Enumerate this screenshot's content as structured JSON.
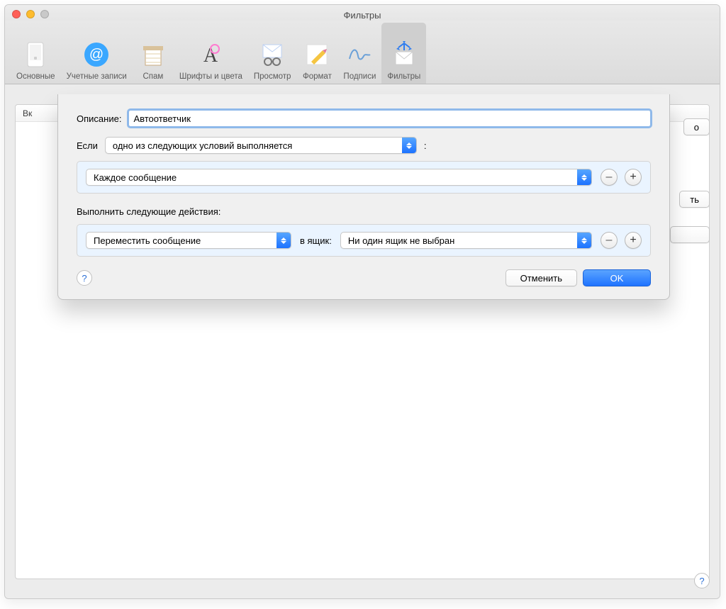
{
  "window": {
    "title": "Фильтры"
  },
  "toolbar": {
    "items": [
      {
        "label": "Основные"
      },
      {
        "label": "Учетные записи"
      },
      {
        "label": "Спам"
      },
      {
        "label": "Шрифты и цвета"
      },
      {
        "label": "Просмотр"
      },
      {
        "label": "Формат"
      },
      {
        "label": "Подписи"
      },
      {
        "label": "Фильтры"
      }
    ],
    "active_index": 7
  },
  "background_list": {
    "header": "Вк",
    "side_buttons": {
      "b1_tail": "о",
      "b2_tail": "ть"
    }
  },
  "sheet": {
    "description_label": "Описание:",
    "description_value": "Автоответчик",
    "if_label": "Если",
    "if_select": "одно из следующих условий выполняется",
    "if_trailing": ":",
    "condition_select": "Каждое сообщение",
    "actions_heading": "Выполнить следующие действия:",
    "action_select": "Переместить сообщение",
    "to_mailbox_label": "в ящик:",
    "mailbox_select": "Ни один ящик не выбран",
    "buttons": {
      "cancel": "Отменить",
      "ok": "OK"
    },
    "help": "?",
    "minus": "–",
    "plus": "+"
  },
  "global_help": "?"
}
